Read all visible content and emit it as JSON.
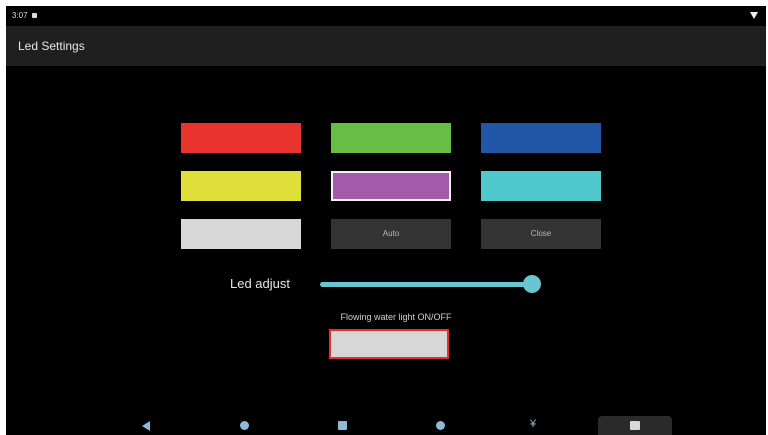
{
  "status": {
    "time": "3:07",
    "signal_icon": "wifi-signal-icon"
  },
  "app": {
    "title": "Led Settings"
  },
  "colors": {
    "red": "#e8332e",
    "green": "#67be45",
    "blue": "#2256a6",
    "yellow": "#e0e03a",
    "purple": "#a35ba9",
    "cyan": "#4fc8cc",
    "white": "#d8d8d8"
  },
  "buttons": {
    "auto": "Auto",
    "close": "Close"
  },
  "led_adjust": {
    "label": "Led adjust",
    "level_fraction": 1.0
  },
  "flowing": {
    "label": "Flowing water light ON/OFF"
  },
  "navbar": {
    "icons": [
      "back-icon",
      "home-icon",
      "recent-apps-icon",
      "dot-icon",
      "yen-icon",
      "screenshot-icon"
    ],
    "yen_glyph": "¥"
  }
}
